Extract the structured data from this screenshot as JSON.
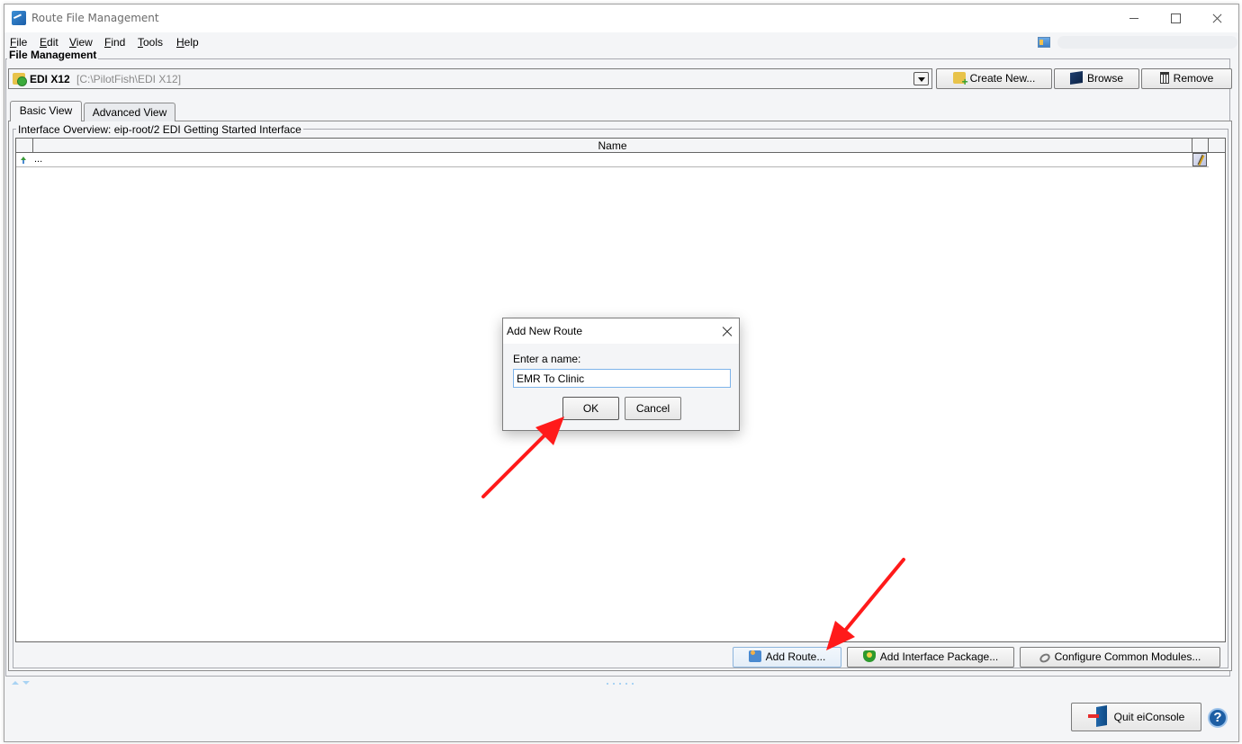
{
  "window": {
    "title": "Route File Management",
    "controls": {
      "minimize": "minimize",
      "maximize": "maximize",
      "close": "close"
    }
  },
  "menubar": {
    "items": [
      {
        "label": "File",
        "mnemonic": "F",
        "rest": "ile"
      },
      {
        "label": "Edit",
        "mnemonic": "E",
        "rest": "dit"
      },
      {
        "label": "View",
        "mnemonic": "V",
        "rest": "iew"
      },
      {
        "label": "Find",
        "mnemonic": "F",
        "rest": "ind"
      },
      {
        "label": "Tools",
        "mnemonic": "T",
        "rest": "ools"
      },
      {
        "label": "Help",
        "mnemonic": "H",
        "rest": "elp"
      }
    ]
  },
  "file_management": {
    "group_label": "File Management",
    "selected_project": {
      "name": "EDI X12",
      "path": "[C:\\PilotFish\\EDI X12]"
    },
    "buttons": {
      "create_new": "Create New...",
      "browse": "Browse",
      "remove": "Remove"
    }
  },
  "tabs": [
    {
      "label": "Basic View",
      "active": true
    },
    {
      "label": "Advanced View",
      "active": false
    }
  ],
  "interface_overview": {
    "group_label": "Interface Overview: eip-root/2 EDI Getting Started Interface",
    "table": {
      "columns": [
        "Name"
      ],
      "rows": [
        {
          "name": "..."
        }
      ]
    },
    "buttons": {
      "add_route": "Add Route...",
      "add_interface_package": "Add Interface Package...",
      "configure_common_modules": "Configure Common Modules..."
    }
  },
  "footer": {
    "quit_label": "Quit eiConsole",
    "help_glyph": "?"
  },
  "dialog": {
    "title": "Add New Route",
    "prompt": "Enter a name:",
    "input_value": "EMR To Clinic",
    "ok_label": "OK",
    "cancel_label": "Cancel"
  },
  "annotations": {
    "arrow_color": "#ff1a1a",
    "arrows": [
      {
        "points_to": "dialog-ok-button"
      },
      {
        "points_to": "add-route-button"
      }
    ]
  }
}
